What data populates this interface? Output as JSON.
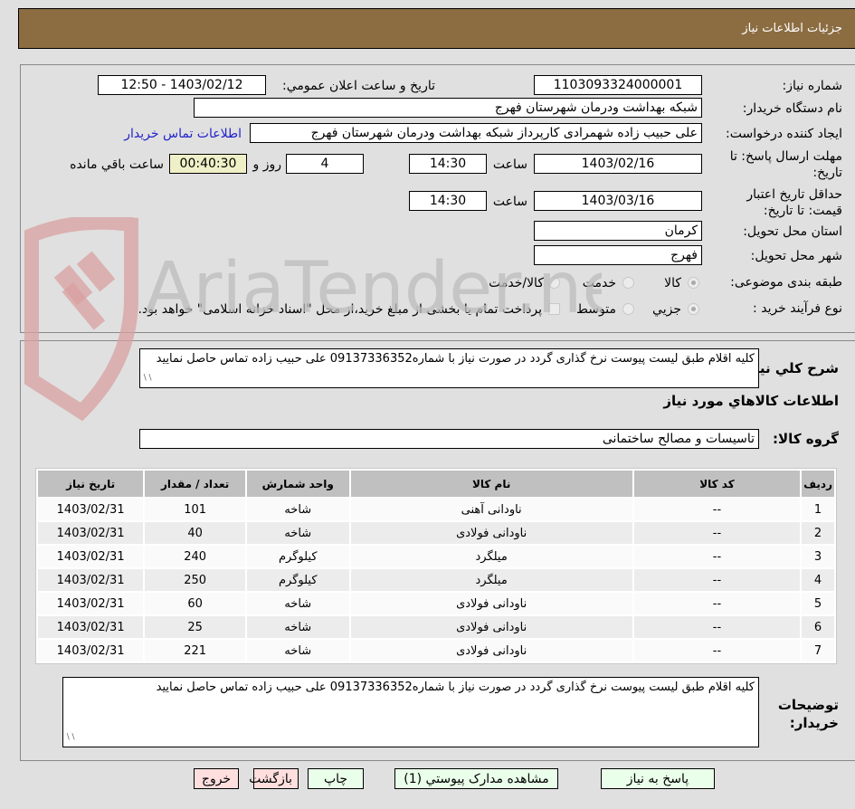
{
  "header": {
    "title": "جزئيات اطلاعات نياز"
  },
  "form": {
    "need_number": {
      "label": "شماره نیاز:",
      "value": "1103093324000001"
    },
    "announce_datetime": {
      "label": "تاريخ و ساعت اعلان عمومي:",
      "value": "1403/02/12 - 12:50"
    },
    "buyer_org": {
      "label": "نام دستگاه خریدار:",
      "value": "شبکه بهداشت ودرمان شهرستان فهرج"
    },
    "requester": {
      "label": "ایجاد کننده درخواست:",
      "value": "علی حبیب زاده شهمرادی کارپرداز شبکه بهداشت ودرمان شهرستان فهرج"
    },
    "buyer_contact_link": "اطلاعات تماس خریدار",
    "response_deadline": {
      "label": "مهلت ارسال پاسخ: تا تاریخ:",
      "date": "1403/02/16",
      "time_label": "ساعت",
      "time": "14:30",
      "days": "4",
      "days_label": "روز و",
      "remaining": "00:40:30",
      "remaining_label": "ساعت باقي مانده"
    },
    "price_validity": {
      "label": "حداقل تاریخ اعتبار قیمت: تا تاریخ:",
      "date": "1403/03/16",
      "time_label": "ساعت",
      "time": "14:30"
    },
    "delivery_province": {
      "label": "استان محل تحویل:",
      "value": "کرمان"
    },
    "delivery_city": {
      "label": "شهر محل تحویل:",
      "value": "فهرج"
    },
    "category": {
      "label": "طبقه بندی موضوعی:",
      "options": [
        "کالا",
        "خدمت",
        "کالا/خدمت"
      ],
      "selected": "کالا"
    },
    "purchase_type": {
      "label": "نوع فرآیند خرید :",
      "options": [
        "جزيي",
        "متوسط"
      ],
      "selected": "جزيي",
      "treasury_note": "پرداخت تمام یا بخشی از مبلغ خرید،از محل \"اسناد خزانه اسلامی\" خواهد بود."
    }
  },
  "details": {
    "general_desc_label": "شرح كلي نياز:",
    "general_desc": "کلیه اقلام طبق لیست پیوست نرخ گذاری گردد در صورت نیاز با شماره09137336352 علی حبیب زاده تماس حاصل نمایید",
    "goods_info_title": "اطلاعات كالاهاي مورد نياز",
    "goods_group_label": "گروه کالا:",
    "goods_group": "تاسیسات و مصالح ساختمانی",
    "table": {
      "headers": [
        "رديف",
        "کد کالا",
        "نام کالا",
        "واحد شمارش",
        "تعداد / مقدار",
        "تاریخ نیاز"
      ],
      "rows": [
        [
          "1",
          "--",
          "ناودانی آهنی",
          "شاخه",
          "101",
          "1403/02/31"
        ],
        [
          "2",
          "--",
          "ناودانی فولادی",
          "شاخه",
          "40",
          "1403/02/31"
        ],
        [
          "3",
          "--",
          "میلگرد",
          "کیلوگرم",
          "240",
          "1403/02/31"
        ],
        [
          "4",
          "--",
          "میلگرد",
          "کیلوگرم",
          "250",
          "1403/02/31"
        ],
        [
          "5",
          "--",
          "ناودانی فولادی",
          "شاخه",
          "60",
          "1403/02/31"
        ],
        [
          "6",
          "--",
          "ناودانی فولادی",
          "شاخه",
          "25",
          "1403/02/31"
        ],
        [
          "7",
          "--",
          "ناودانی فولادی",
          "شاخه",
          "221",
          "1403/02/31"
        ]
      ]
    },
    "buyer_notes_label": "توضیحات خریدار:",
    "buyer_notes": "کلیه اقلام طبق لیست پیوست نرخ گذاری گردد در صورت نیاز با شماره09137336352 علی حبیب زاده تماس حاصل نمایید"
  },
  "buttons": {
    "respond": "پاسخ به نیاز",
    "attachments": "مشاهده مدارک پیوستي (1)",
    "print": "چاپ",
    "back": "بازگشت",
    "exit": "خروج"
  },
  "watermark": {
    "text": "AriaTender.neT"
  },
  "colors": {
    "header_bg": "#8c6d42",
    "link": "#2222cc",
    "remaining_bg": "#f0f0c8",
    "btn_green": "#eaffea",
    "btn_pink": "#ffdede"
  }
}
